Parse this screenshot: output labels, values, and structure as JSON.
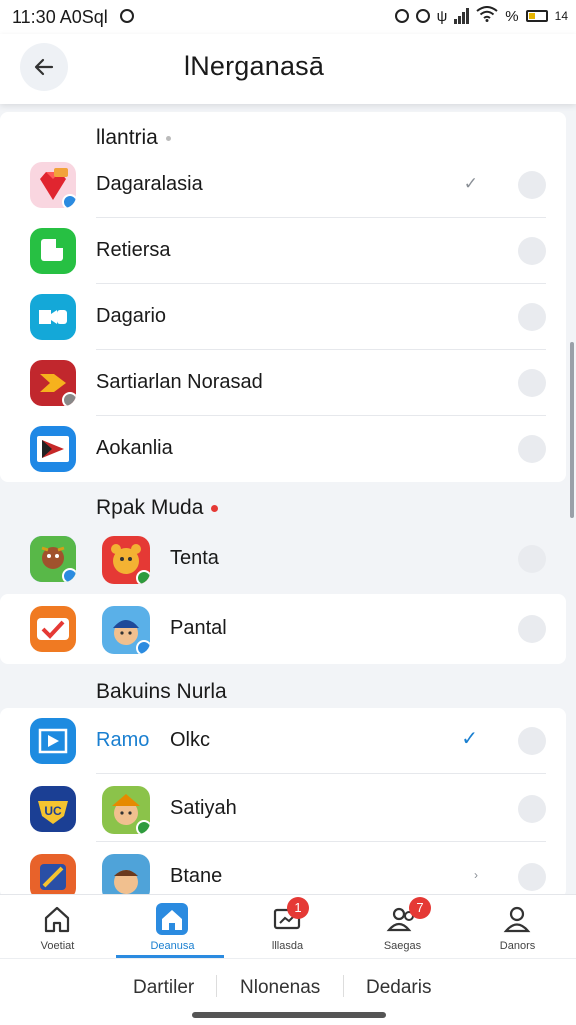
{
  "status": {
    "time": "11:30 A0Sql",
    "battery_text": "% ",
    "extra": "14"
  },
  "header": {
    "title": "lNerganasā"
  },
  "sections": [
    {
      "title": "llantria",
      "items": [
        {
          "label": "Dagaralasia",
          "icon": "red-diamond-app-icon",
          "checked": true
        },
        {
          "label": "Retiersa",
          "icon": "green-square-app-icon"
        },
        {
          "label": "Dagario",
          "icon": "teal-video-app-icon"
        },
        {
          "label": "Sartiarlan Norasad",
          "icon": "red-arrow-app-icon"
        },
        {
          "label": "Aokanlia",
          "icon": "blue-play-app-icon"
        }
      ]
    },
    {
      "title": "Rpak Muda",
      "items": [
        {
          "label": "Tenta",
          "icon": "game-character-app-icon"
        },
        {
          "label": "Pantal",
          "icon": "orange-check-app-icon"
        }
      ]
    },
    {
      "title": "Bakuins Nurla",
      "items": [
        {
          "label_a": "Ramo",
          "label_b": "Olkc",
          "icon": "blue-screen-app-icon",
          "checked": true
        },
        {
          "label": "Satiyah",
          "icon": "blue-badge-app-icon"
        },
        {
          "label": "Btane",
          "icon": "orange-game-app-icon"
        }
      ]
    }
  ],
  "bottom_nav": {
    "tabs": [
      {
        "label": "Voetiat",
        "icon": "home-outline-icon"
      },
      {
        "label": "Deanusa",
        "icon": "home-filled-icon",
        "active": true
      },
      {
        "label": "lllasda",
        "icon": "message-icon",
        "badge": "1"
      },
      {
        "label": "Saegas",
        "icon": "people-icon",
        "badge": "7"
      },
      {
        "label": "Danors",
        "icon": "person-icon"
      }
    ]
  },
  "sub_bar": {
    "items": [
      "Dartiler",
      "Nlonenas",
      "Dedaris"
    ]
  },
  "colors": {
    "accent": "#2b8be0",
    "badge": "#e53935"
  }
}
